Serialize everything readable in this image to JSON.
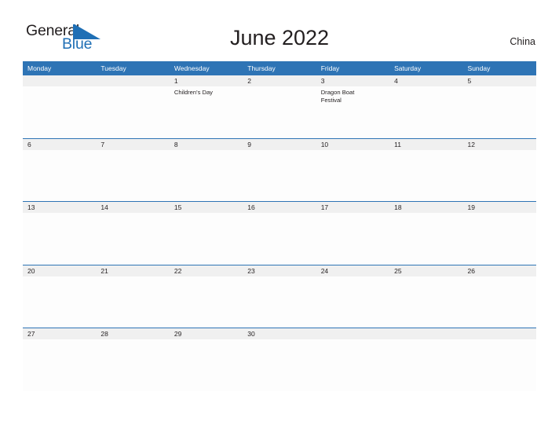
{
  "logo": {
    "word_top": "General",
    "word_bottom": "Blue",
    "flag_icon": "blue-flag-triangle-icon",
    "brand_color": "#1f6fb5"
  },
  "header": {
    "title": "June 2022",
    "country": "China"
  },
  "calendar": {
    "header_color": "#2e74b5",
    "day_band_color": "#f0f0f0",
    "weekdays": [
      "Monday",
      "Tuesday",
      "Wednesday",
      "Thursday",
      "Friday",
      "Saturday",
      "Sunday"
    ],
    "weeks": [
      [
        {
          "day": "",
          "events": []
        },
        {
          "day": "",
          "events": []
        },
        {
          "day": "1",
          "events": [
            "Children's Day"
          ]
        },
        {
          "day": "2",
          "events": []
        },
        {
          "day": "3",
          "events": [
            "Dragon Boat",
            "Festival"
          ]
        },
        {
          "day": "4",
          "events": []
        },
        {
          "day": "5",
          "events": []
        }
      ],
      [
        {
          "day": "6",
          "events": []
        },
        {
          "day": "7",
          "events": []
        },
        {
          "day": "8",
          "events": []
        },
        {
          "day": "9",
          "events": []
        },
        {
          "day": "10",
          "events": []
        },
        {
          "day": "11",
          "events": []
        },
        {
          "day": "12",
          "events": []
        }
      ],
      [
        {
          "day": "13",
          "events": []
        },
        {
          "day": "14",
          "events": []
        },
        {
          "day": "15",
          "events": []
        },
        {
          "day": "16",
          "events": []
        },
        {
          "day": "17",
          "events": []
        },
        {
          "day": "18",
          "events": []
        },
        {
          "day": "19",
          "events": []
        }
      ],
      [
        {
          "day": "20",
          "events": []
        },
        {
          "day": "21",
          "events": []
        },
        {
          "day": "22",
          "events": []
        },
        {
          "day": "23",
          "events": []
        },
        {
          "day": "24",
          "events": []
        },
        {
          "day": "25",
          "events": []
        },
        {
          "day": "26",
          "events": []
        }
      ],
      [
        {
          "day": "27",
          "events": []
        },
        {
          "day": "28",
          "events": []
        },
        {
          "day": "29",
          "events": []
        },
        {
          "day": "30",
          "events": []
        },
        {
          "day": "",
          "events": []
        },
        {
          "day": "",
          "events": []
        },
        {
          "day": "",
          "events": []
        }
      ]
    ]
  }
}
